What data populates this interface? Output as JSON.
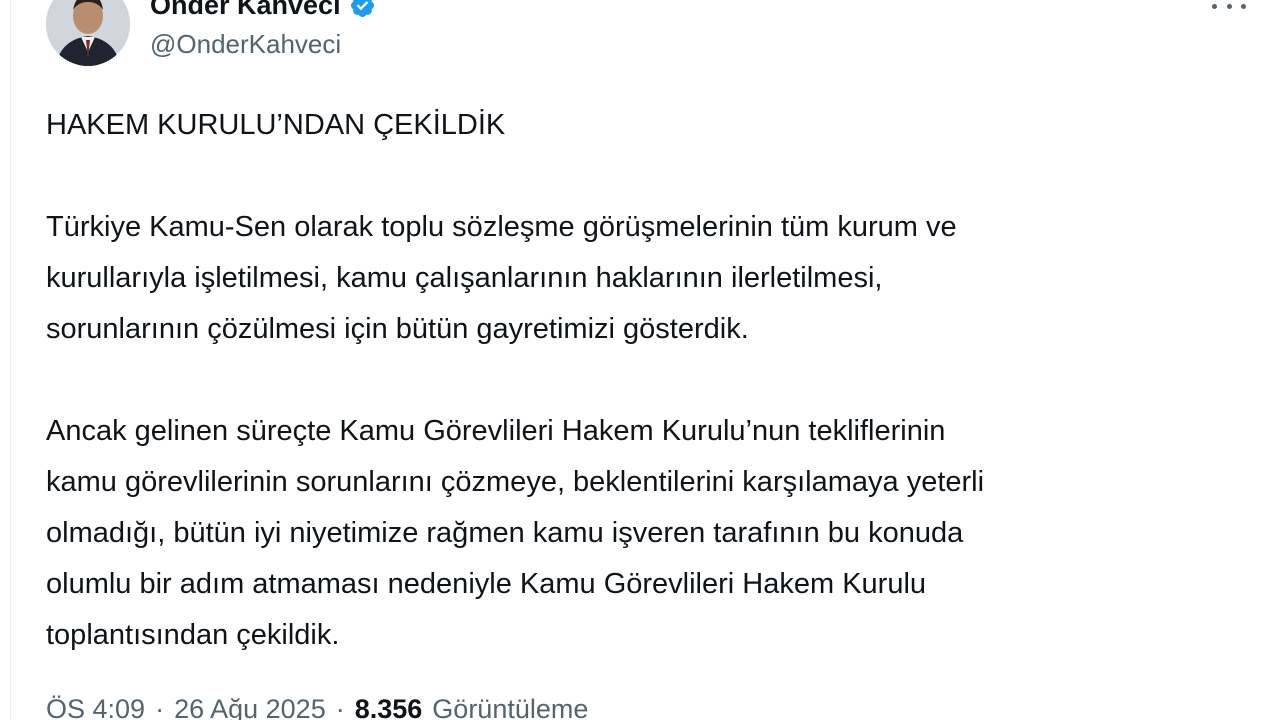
{
  "author": {
    "display_name": "Önder Kahveci",
    "handle": "@OnderKahveci",
    "verified": true,
    "verified_color": "#1d9bf0"
  },
  "icons": {
    "avatar": "profile-photo",
    "verified": "verified-badge-icon",
    "more": "more-options-icon"
  },
  "tweet": {
    "heading": "HAKEM KURULU’NDAN ÇEKİLDİK",
    "paragraph_1": [
      "Türkiye Kamu-Sen olarak toplu sözleşme görüşmelerinin tüm kurum ve",
      "kurullarıyla işletilmesi, kamu çalışanlarının haklarının ilerletilmesi,",
      "sorunlarının çözülmesi için bütün gayretimizi gösterdik."
    ],
    "paragraph_2": [
      "Ancak gelinen süreçte Kamu Görevlileri Hakem Kurulu’nun tekliflerinin",
      "kamu görevlilerinin sorunlarını çözmeye, beklentilerini karşılamaya yeterli",
      "olmadığı, bütün iyi niyetimize rağmen kamu işveren tarafının bu konuda",
      "olumlu bir adım atmaması nedeniyle Kamu Görevlileri Hakem Kurulu",
      "toplantısından çekildik."
    ]
  },
  "meta": {
    "time": "ÖS 4:09",
    "separator": "·",
    "date": "26 Ağu 2025",
    "views_count": "8.356",
    "views_label": "Görüntüleme"
  }
}
